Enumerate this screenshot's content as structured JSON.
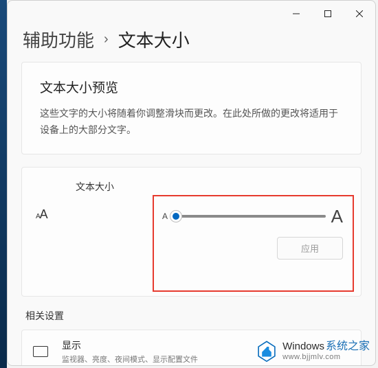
{
  "breadcrumb": {
    "parent": "辅助功能",
    "current": "文本大小"
  },
  "preview": {
    "title": "文本大小预览",
    "body": "这些文字的大小将随着你调整滑块而更改。在此处所做的更改将适用于设备上的大部分文字。"
  },
  "slider": {
    "label": "文本大小",
    "min_glyph": "A",
    "max_glyph": "A",
    "apply_label": "应用",
    "value_percent": 2
  },
  "related": {
    "heading": "相关设置",
    "display": {
      "title": "显示",
      "subtitle": "监视器、亮度、夜间模式、显示配置文件"
    }
  },
  "watermark": {
    "brand_en": "Windows",
    "brand_zh": "系统之家",
    "url": "www.bjjmlv.com"
  },
  "window_controls": {
    "minimize": "minimize",
    "maximize": "maximize",
    "close": "close"
  }
}
